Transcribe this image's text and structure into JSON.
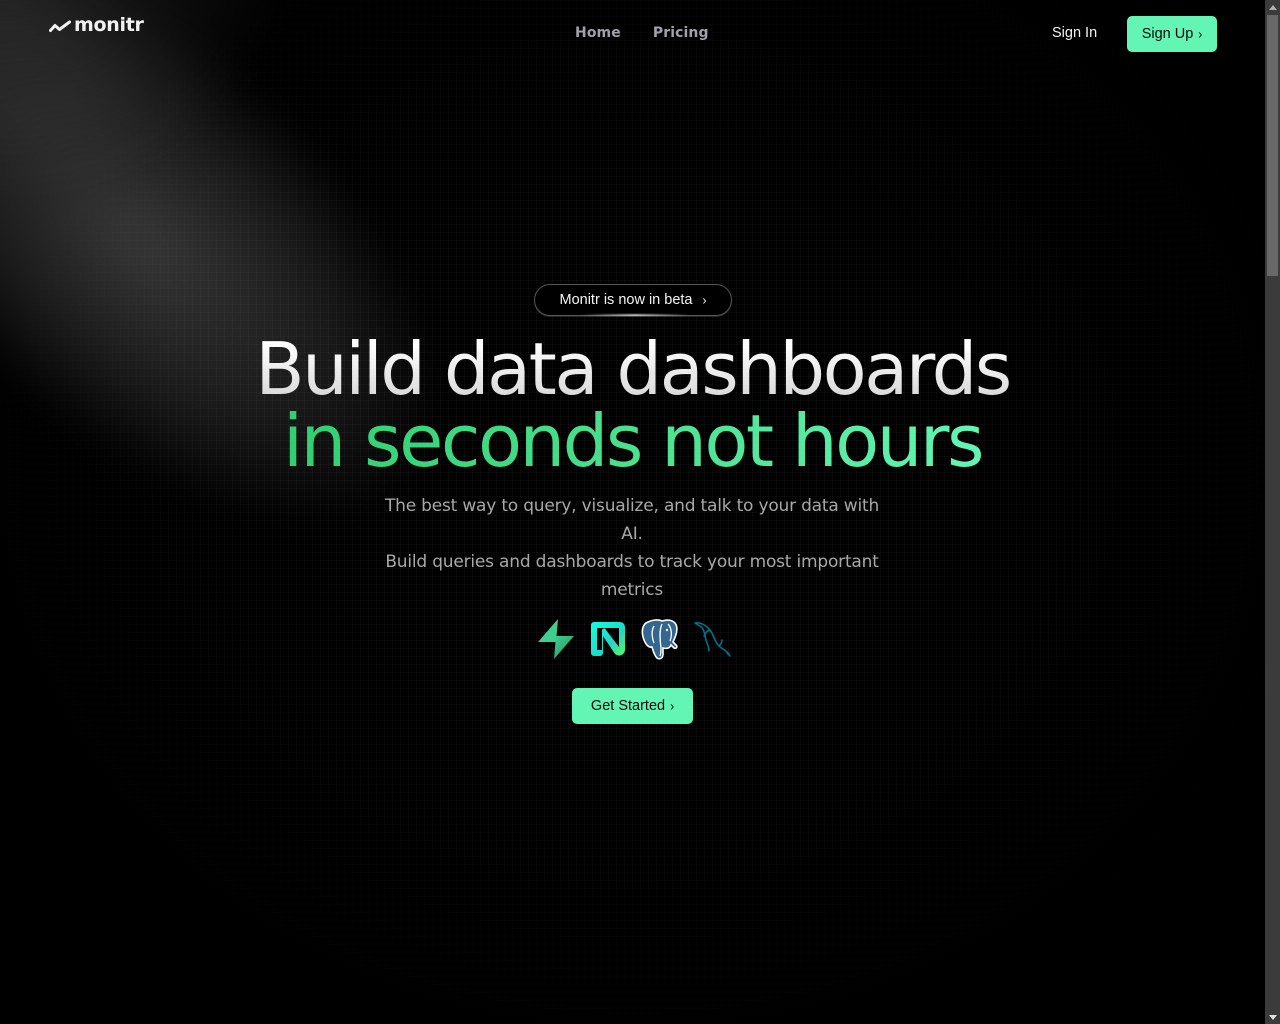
{
  "brand": {
    "name": "monitr",
    "logo_icon": "trend-line-icon"
  },
  "nav": {
    "items": [
      {
        "label": "Home"
      },
      {
        "label": "Pricing"
      }
    ]
  },
  "auth": {
    "sign_in": "Sign In",
    "sign_up": "Sign Up",
    "chevron": "›"
  },
  "hero": {
    "badge": "Monitr is now in beta",
    "badge_chevron": "›",
    "title_line1": "Build data dashboards",
    "title_line2": "in seconds not hours",
    "subtitle_line1": "The best way to query, visualize, and talk to your data with AI.",
    "subtitle_line2": "Build queries and dashboards to track your most important metrics",
    "integrations": [
      {
        "name": "Supabase",
        "icon": "supabase-icon"
      },
      {
        "name": "Neon",
        "icon": "neon-icon"
      },
      {
        "name": "PostgreSQL",
        "icon": "postgresql-icon"
      },
      {
        "name": "MySQL",
        "icon": "mysql-icon"
      }
    ],
    "cta": "Get Started",
    "cta_chevron": "›"
  },
  "colors": {
    "accent": "#63f5b4",
    "accent_dark": "#2fcf6f",
    "background": "#000000",
    "nav_text": "#a1a1aa",
    "subtitle_text": "#a8a8a8"
  }
}
